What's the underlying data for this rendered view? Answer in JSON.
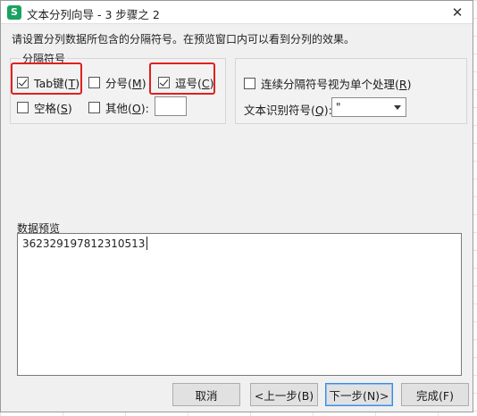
{
  "window": {
    "title": "文本分列向导 - 3 步骤之 2",
    "close_glyph": "✕",
    "app_icon": "S"
  },
  "instruction": "请设置分列数据所包含的分隔符号。在预览窗口内可以看到分列的效果。",
  "delimiters": {
    "group_label": "分隔符号",
    "tab": {
      "label": "Tab键",
      "key": "T",
      "checked": true
    },
    "semicolon": {
      "label": "分号",
      "key": "M",
      "checked": false
    },
    "comma": {
      "label": "逗号",
      "key": "C",
      "checked": true
    },
    "space": {
      "label": "空格",
      "key": "S",
      "checked": false
    },
    "other": {
      "label": "其他",
      "key": "O",
      "checked": false,
      "value": ""
    }
  },
  "options": {
    "consecutive": {
      "label": "连续分隔符号视为单个处理",
      "key": "R",
      "checked": false
    },
    "qualifier": {
      "label": "文本识别符号",
      "key": "Q",
      "value": "\""
    }
  },
  "preview": {
    "label": "数据预览",
    "content": "362329197812310513"
  },
  "buttons": {
    "cancel": "取消",
    "back": "<上一步(B)",
    "next": "下一步(N)>",
    "finish": "完成(F)"
  },
  "colors": {
    "highlight": "#e02020",
    "app_icon": "#1aa260",
    "default_button_border": "#3c8be0"
  }
}
